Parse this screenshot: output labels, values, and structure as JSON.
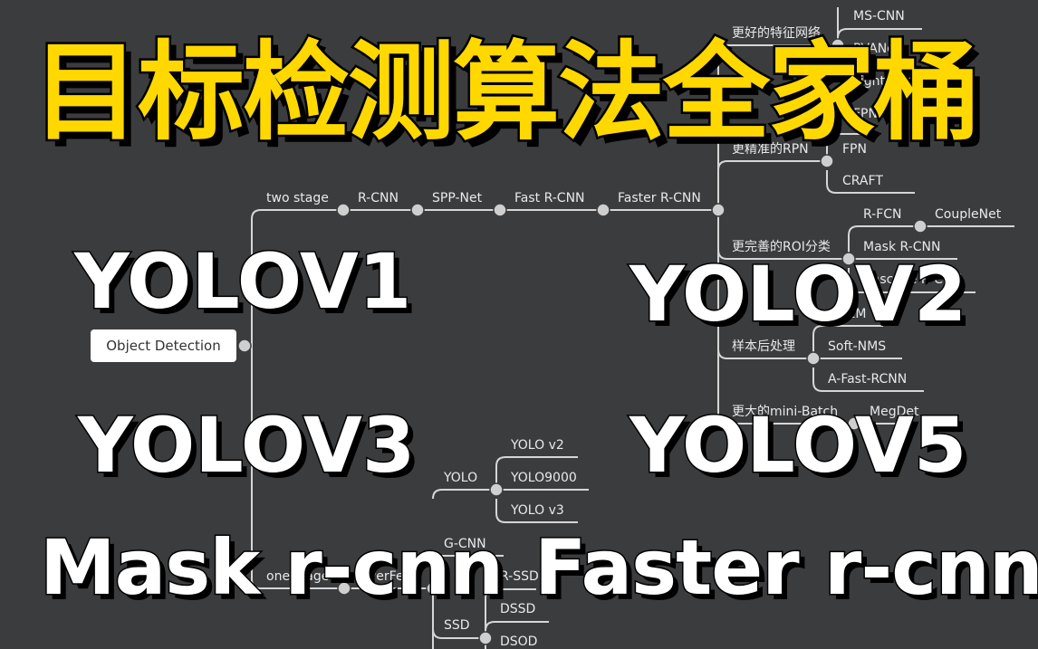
{
  "root": "Object Detection",
  "two_stage": {
    "label": "two stage",
    "chain": [
      "R-CNN",
      "SPP-Net",
      "Fast R-CNN",
      "Faster R-CNN"
    ],
    "branches": [
      {
        "label": "更好的特征网络",
        "children": [
          "MS-CNN",
          "PVANet",
          "Light-Head",
          "FPN"
        ]
      },
      {
        "label": "更精准的RPN",
        "children": [
          "FPN",
          "CRAFT"
        ]
      },
      {
        "label": "更完善的ROI分类",
        "children": [
          "R-FCN",
          "CoupleNet",
          "Mask R-CNN",
          "Cascade R-CNN"
        ]
      },
      {
        "label": "样本后处理",
        "children": [
          "OHEM",
          "Soft-NMS",
          "A-Fast-RCNN"
        ]
      },
      {
        "label": "更大的mini-Batch",
        "children": [
          "MegDet"
        ]
      }
    ]
  },
  "one_stage": {
    "label": "one stage",
    "chain": [
      "OverFeat"
    ],
    "branches": [
      {
        "label": "YOLO",
        "children": [
          "YOLO v2",
          "YOLO9000",
          "YOLO v3"
        ]
      },
      {
        "label": "G-CNN",
        "children": []
      },
      {
        "label": "SSD",
        "children": [
          "R-SSD",
          "DSSD",
          "DSOD"
        ]
      }
    ]
  },
  "overlay": {
    "title": "目标检测算法全家桶",
    "title_color": "#ffd800",
    "tags": [
      "YOLOV1",
      "YOLOV2",
      "YOLOV3",
      "YOLOV5",
      "Mask r-cnn",
      "Faster r-cnn"
    ]
  }
}
